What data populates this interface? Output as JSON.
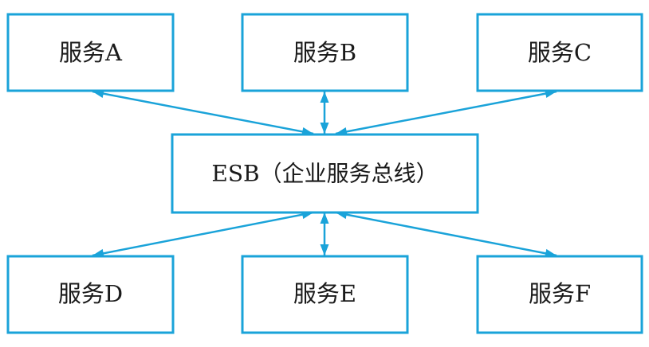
{
  "colors": {
    "line": "#1aa3d9",
    "text": "#1a1a1a",
    "background": "#ffffff"
  },
  "bus": {
    "label": "ESB（企业服务总线）"
  },
  "services": {
    "a": "服务A",
    "b": "服务B",
    "c": "服务C",
    "d": "服务D",
    "e": "服务E",
    "f": "服务F"
  },
  "connections": [
    {
      "from": "bus",
      "to": "a",
      "bidirectional": true
    },
    {
      "from": "bus",
      "to": "b",
      "bidirectional": true
    },
    {
      "from": "bus",
      "to": "c",
      "bidirectional": true
    },
    {
      "from": "bus",
      "to": "d",
      "bidirectional": true
    },
    {
      "from": "bus",
      "to": "e",
      "bidirectional": true
    },
    {
      "from": "bus",
      "to": "f",
      "bidirectional": true
    }
  ]
}
